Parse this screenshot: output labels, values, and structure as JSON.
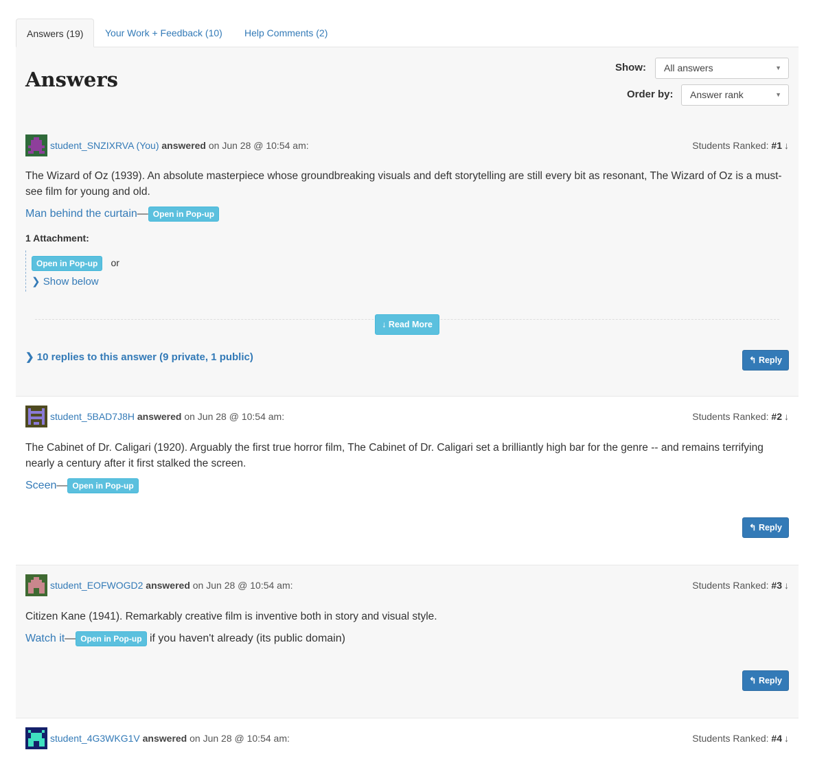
{
  "tabs": [
    {
      "label": "Answers (19)"
    },
    {
      "label": "Your Work + Feedback (10)"
    },
    {
      "label": "Help Comments (2)"
    }
  ],
  "header": {
    "title": "Answers",
    "show_label": "Show:",
    "show_value": "All answers",
    "order_label": "Order by:",
    "order_value": "Answer rank"
  },
  "common": {
    "answered": "answered",
    "rank_label": "Students Ranked:",
    "open_popup": "Open in Pop-up",
    "reply": "Reply",
    "dash": "—"
  },
  "answers": [
    {
      "user": "student_SNZIXRVA (You)",
      "date": "on Jun 28 @ 10:54 am:",
      "rank": "#1",
      "text": "The Wizard of Oz (1939). An absolute masterpiece whose groundbreaking visuals and deft storytelling are still every bit as resonant, The Wizard of Oz is a must-see film for young and old.",
      "link": "Man behind the curtain",
      "attachments": "1 Attachment:",
      "or": "or",
      "show_below": "Show below",
      "read_more": "Read More",
      "replies": "10 replies to this answer (9 private, 1 public)",
      "avatar_color": "#8e3f9b",
      "avatar_bg": "#2f6a3a"
    },
    {
      "user": "student_5BAD7J8H",
      "date": "on Jun 28 @ 10:54 am:",
      "rank": "#2",
      "text": "The Cabinet of Dr. Caligari (1920). Arguably the first true horror film, The Cabinet of Dr. Caligari set a brilliantly high bar for the genre -- and remains terrifying nearly a century after it first stalked the screen.",
      "link": "Sceen",
      "avatar_color": "#8a7ad6",
      "avatar_bg": "#4e4a20"
    },
    {
      "user": "student_EOFWOGD2",
      "date": "on Jun 28 @ 10:54 am:",
      "rank": "#3",
      "text": "Citizen Kane (1941). Remarkably creative film is inventive both in story and visual style.",
      "link": "Watch it",
      "suffix": "if you haven't already (its public domain)",
      "avatar_color": "#c9878d",
      "avatar_bg": "#3f6a32"
    },
    {
      "user": "student_4G3WKG1V",
      "date": "on Jun 28 @ 10:54 am:",
      "rank": "#4",
      "avatar_color": "#3fe0c0",
      "avatar_bg": "#14206a"
    }
  ]
}
